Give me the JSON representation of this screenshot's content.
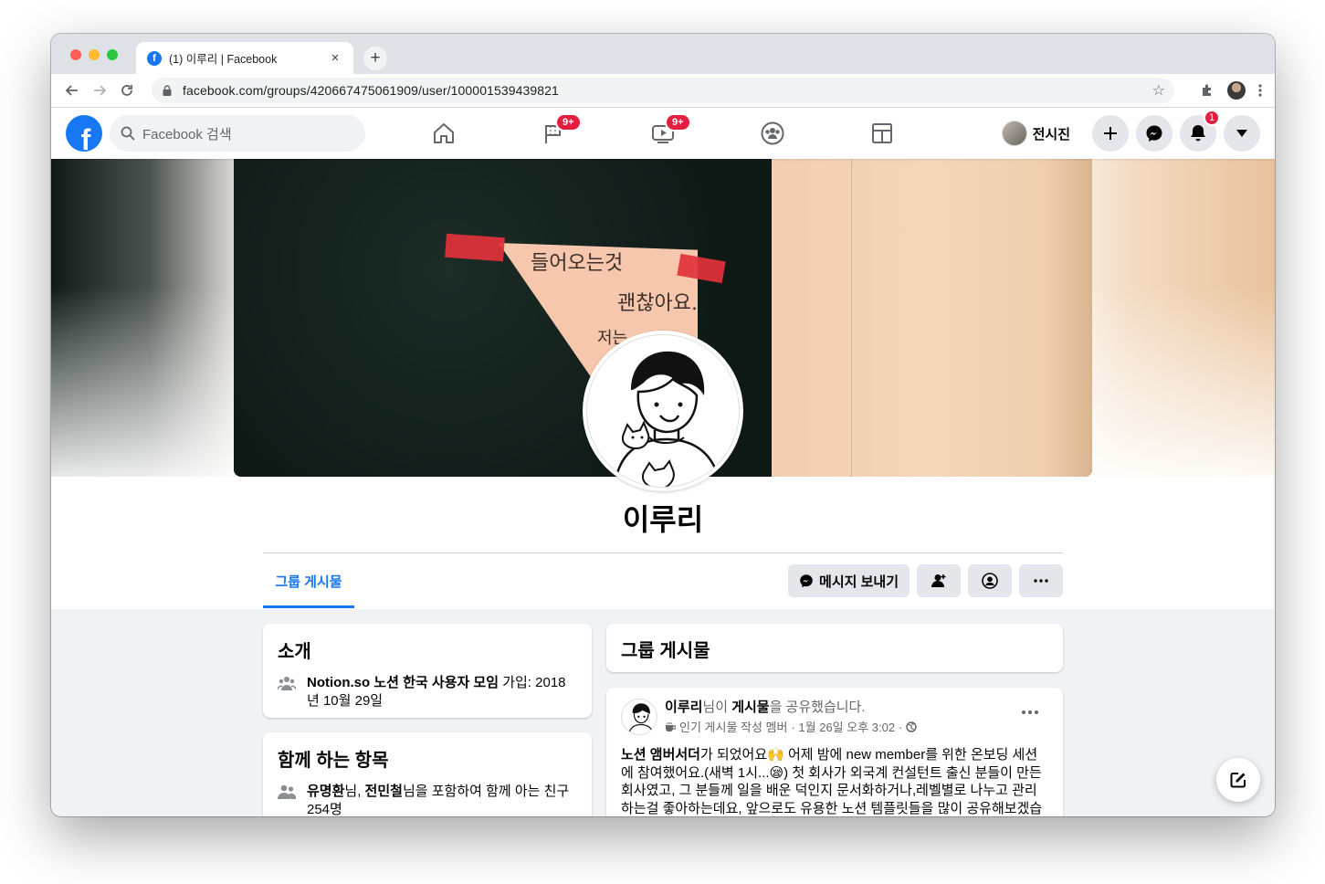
{
  "browser": {
    "tab_title": "(1) 이루리 | Facebook",
    "tab_close": "×",
    "new_tab": "+",
    "url": "facebook.com/groups/420667475061909/user/100001539439821"
  },
  "header": {
    "logo": "f",
    "search_placeholder": "Facebook 검색",
    "nav": [
      {
        "name": "home",
        "badge": ""
      },
      {
        "name": "pages",
        "badge": "9+"
      },
      {
        "name": "watch",
        "badge": "9+"
      },
      {
        "name": "groups",
        "badge": ""
      },
      {
        "name": "gaming",
        "badge": ""
      }
    ],
    "user_name": "전시진",
    "notification_count": "1"
  },
  "profile": {
    "name": "이루리",
    "cover_text": [
      "들어오는것",
      "괜찮아요.",
      "저는"
    ],
    "tab_label": "그룹 게시물",
    "message_button": "메시지 보내기"
  },
  "intro": {
    "title": "소개",
    "group_name": "Notion.so 노션 한국 사용자 모임",
    "joined_label": " 가입: 2018년 10월 29일"
  },
  "mutual": {
    "title": "함께 하는 항목",
    "friend1": "유명환",
    "sep": "님, ",
    "friend2": "전민철",
    "rest": "님을 포함하여 함께 아는 친구 254명"
  },
  "group_posts": {
    "title": "그룹 게시물"
  },
  "post": {
    "author": "이루리",
    "shared_mid": "님이 ",
    "shared_obj": "게시물",
    "shared_end": "을 공유했습니다.",
    "badge_text": "인기 게시물 작성 멤버",
    "date": " · 1월 26일 오후 3:02 · ",
    "highlight": "노션 앰버서더",
    "body_1": "가 되었어요🙌 어제 밤에 new member를 위한 온보딩 세션에 참여했어요.(새벽 1시...😪) 첫 회사가 외국계 컨설턴트 출신 분들이 만든 회사였고, 그 분들께 일을 배운 덕인지 문서화하거나,레벨별로 나누고 관리하는걸 좋아하는데요, 앞으로도 유용한 노션 템플릿들을 많이 공유해보겠습니다."
  },
  "colors": {
    "brand": "#1877f2",
    "badge": "#e41e3f",
    "page_bg": "#f0f2f5"
  }
}
